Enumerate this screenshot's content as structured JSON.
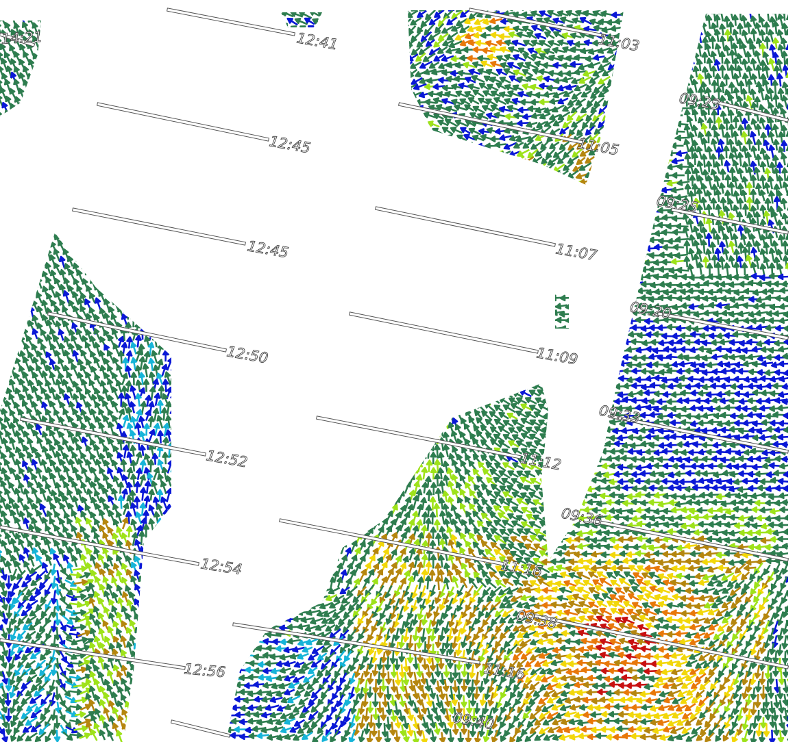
{
  "map": {
    "title": "",
    "colors": {
      "dark_green": "#2e7d4f",
      "blue": "#0a18d6",
      "cyan": "#16b4d8",
      "lime": "#9ee21a",
      "ochre": "#b5860f",
      "yellow": "#f2d70a",
      "orange": "#e8780a",
      "red": "#c81010",
      "gray": "#777777"
    },
    "tracks": [
      {
        "label": "14:21"
      },
      {
        "label": "12:41"
      },
      {
        "label": "12:45"
      },
      {
        "label": "12:45"
      },
      {
        "label": "12:50"
      },
      {
        "label": "12:52"
      },
      {
        "label": "12:54"
      },
      {
        "label": "12:56"
      },
      {
        "label": "11:03"
      },
      {
        "label": "11:05"
      },
      {
        "label": "11:07"
      },
      {
        "label": "11:09"
      },
      {
        "label": "11:12"
      },
      {
        "label": "11:16"
      },
      {
        "label": "11:16"
      },
      {
        "label": "09:23"
      },
      {
        "label": "09:25"
      },
      {
        "label": "09:20"
      },
      {
        "label": "09:33"
      },
      {
        "label": "09:36"
      },
      {
        "label": "09:38"
      },
      {
        "label": "09:40"
      }
    ]
  }
}
